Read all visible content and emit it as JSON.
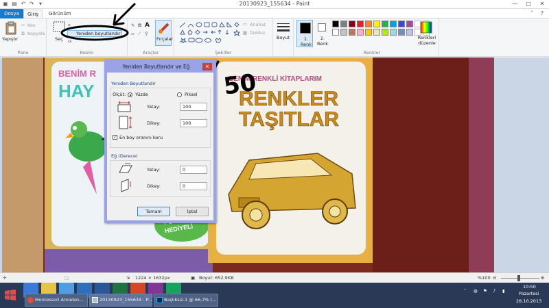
{
  "window": {
    "title": "20130923_155634 - Paint",
    "controls": {
      "minimize": "—",
      "maximize": "□",
      "close": "✕"
    }
  },
  "ribbon": {
    "tabs": [
      "Dosya",
      "Giriş",
      "Görünüm"
    ],
    "pano": {
      "label": "Pano",
      "paste": "Yapıştır",
      "cut": "Kes",
      "copy": "Kopyala"
    },
    "resim": {
      "label": "Resim",
      "select": "Seç",
      "resize": "Yeniden boyutlandır"
    },
    "araclar": {
      "label": "Araçlar",
      "brushes": "Fırçalar"
    },
    "sekiller": {
      "label": "Şekiller",
      "outline": "Anahat",
      "fill": "Dolduz"
    },
    "boyut": "Boyut",
    "renk1": "1. Renk",
    "renk2": "2. Renk",
    "renkler": {
      "label": "Renkler",
      "edit": "Renkleri düzenle",
      "palette_row1": [
        "#000000",
        "#7f7f7f",
        "#880015",
        "#ed1c24",
        "#ff7f27",
        "#fff200",
        "#22b14c",
        "#00a2e8",
        "#3f48cc",
        "#a349a4"
      ],
      "palette_row2": [
        "#ffffff",
        "#c3c3c3",
        "#b97a57",
        "#ffaec9",
        "#ffc90e",
        "#efe4b0",
        "#b5e61d",
        "#99d9ea",
        "#7092be",
        "#c8bfe7"
      ]
    }
  },
  "dialog": {
    "title": "Yeniden Boyutlandır ve Eğ",
    "close": "✕",
    "resize_section": "Yeniden Boyutlandır",
    "by_label": "Ölçüt:",
    "by_percent": "Yüzde",
    "by_pixels": "Piksel",
    "horizontal_label": "Yatay:",
    "horizontal_value": "100",
    "vertical_label": "Dikey:",
    "vertical_value": "100",
    "maintain_aspect": "En boy oranını koru",
    "skew_section": "Eğ (Derece)",
    "skew_horizontal_label": "Yatay:",
    "skew_horizontal_value": "0",
    "skew_vertical_label": "Dikey:",
    "skew_vertical_value": "0",
    "ok": "Tamam",
    "cancel": "İptal"
  },
  "annotation": {
    "text": "50"
  },
  "photo": {
    "left_book_title": "BENİM R",
    "left_book_word": "HAY",
    "left_book_badge_1": "POSTE",
    "left_book_badge_2": "HEDİYELİ",
    "right_book_series": "BENİM RENKLİ KİTAPLARIM",
    "right_book_title_1": "RENKLER",
    "right_book_title_2": "TAŞITLAR"
  },
  "statusbar": {
    "dimensions": "1224 × 1632px",
    "size": "Boyut: 652,9KB",
    "zoom": "%100"
  },
  "taskbar": {
    "tasks": [
      "Montessori Annelen...",
      "20130923_155634 - P...",
      "Başlıksız-1 @ 66,7% (..."
    ],
    "time": "10:50",
    "day": "Pazartesi",
    "date": "28.10.2013"
  }
}
